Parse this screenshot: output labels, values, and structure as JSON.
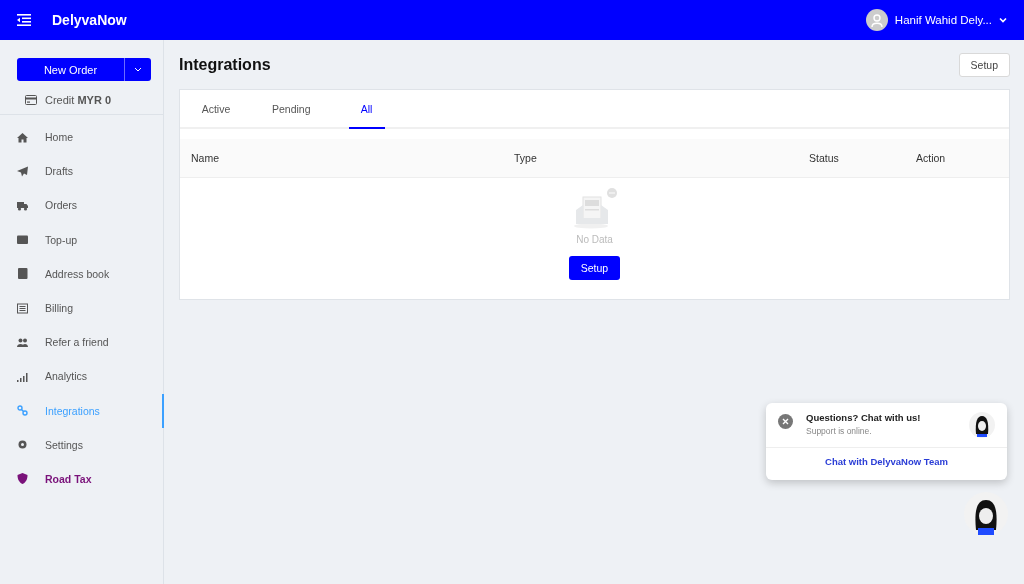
{
  "header": {
    "brand": "DelyvaNow",
    "user": "Hanif Wahid Dely..."
  },
  "sidebar": {
    "new_order": "New Order",
    "credit": "Credit **MYR 0**",
    "items": [
      {
        "label": "Home",
        "selected": false,
        "kind": "link"
      },
      {
        "label": "Drafts",
        "selected": false,
        "kind": "link"
      },
      {
        "label": "Orders",
        "selected": false,
        "kind": "link"
      },
      {
        "label": "Top-up",
        "selected": false,
        "kind": "link"
      },
      {
        "label": "Address book",
        "selected": false,
        "kind": "link"
      },
      {
        "label": "Billing",
        "selected": false,
        "kind": "link"
      },
      {
        "label": "Refer a friend",
        "selected": false,
        "kind": "link"
      },
      {
        "label": "Analytics",
        "selected": false,
        "kind": "link"
      },
      {
        "label": "Integrations",
        "selected": true,
        "kind": "link"
      },
      {
        "label": "Settings",
        "selected": false,
        "kind": "link"
      },
      {
        "label": "Road Tax",
        "selected": false,
        "kind": "promo"
      }
    ]
  },
  "page": {
    "title": "Integrations",
    "setup_button": "Setup"
  },
  "tabs": [
    {
      "label": "Active",
      "selected": false
    },
    {
      "label": "Pending",
      "selected": false
    },
    {
      "label": "All",
      "selected": true
    }
  ],
  "table": {
    "columns": [
      "Name",
      "Type",
      "Status",
      "Action"
    ],
    "empty_text": "No Data",
    "empty_button": "Setup"
  },
  "chat": {
    "title": "Questions? Chat with us!",
    "subtitle": "Support is online.",
    "link": "Chat with DelyvaNow Team"
  }
}
